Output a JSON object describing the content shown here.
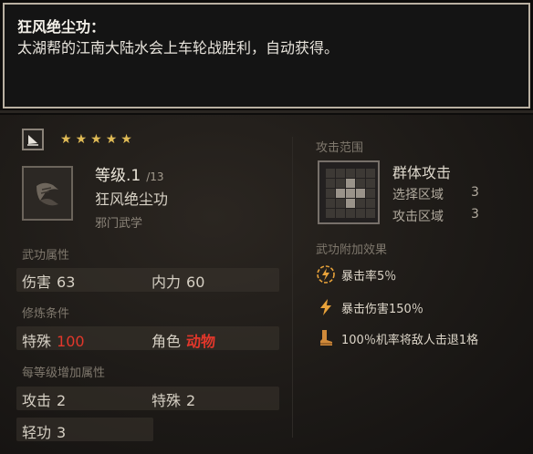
{
  "tooltip": {
    "title": "狂风绝尘功：",
    "description": "太湖帮的江南大陆水会上车轮战胜利，自动获得。"
  },
  "skill": {
    "type_icon": "sail-icon",
    "stars": 5,
    "level_label": "等级.1",
    "level_max": "/13",
    "name": "狂风绝尘功",
    "school": "邪门武学",
    "icon": "scroll-icon"
  },
  "sections": {
    "attributes": "武功属性",
    "requirements": "修炼条件",
    "per_level": "每等级增加属性",
    "range": "攻击范围",
    "effects": "武功附加效果"
  },
  "attributes": {
    "damage_label": "伤害",
    "damage_value": "63",
    "inner_label": "内力",
    "inner_value": "60"
  },
  "requirements": {
    "special_label": "特殊",
    "special_value": "100",
    "role_label": "角色",
    "role_value": "动物"
  },
  "per_level": {
    "attack_label": "攻击",
    "attack_value": "2",
    "special_label": "特殊",
    "special_value": "2",
    "agility_label": "轻功",
    "agility_value": "3"
  },
  "range": {
    "name": "群体攻击",
    "select_label": "选择区域",
    "select_value": "3",
    "attack_label": "攻击区域",
    "attack_value": "3"
  },
  "effects": [
    {
      "icon": "lightning-circle-icon",
      "text": "暴击率5％"
    },
    {
      "icon": "lightning-icon",
      "text": "暴击伤害150％"
    },
    {
      "icon": "boot-icon",
      "text": "100％机率将敌人击退1格"
    }
  ],
  "colors": {
    "accent_red": "#e2372b",
    "star_gold": "#e0bb56",
    "effect_orange": "#e8a23a"
  }
}
